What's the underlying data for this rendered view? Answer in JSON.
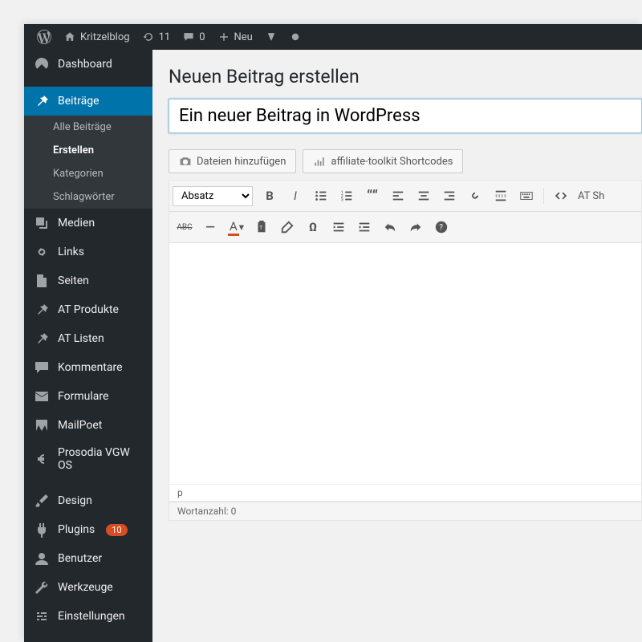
{
  "adminbar": {
    "site_name": "Kritzelblog",
    "updates_count": "11",
    "comments_count": "0",
    "new_label": "Neu"
  },
  "sidebar": {
    "dashboard": "Dashboard",
    "posts": "Beiträge",
    "posts_sub": {
      "all": "Alle Beiträge",
      "create": "Erstellen",
      "categories": "Kategorien",
      "tags": "Schlagwörter"
    },
    "media": "Medien",
    "links": "Links",
    "pages": "Seiten",
    "at_products": "AT Produkte",
    "at_lists": "AT Listen",
    "comments": "Kommentare",
    "forms": "Formulare",
    "mailpoet": "MailPoet",
    "prosodia": "Prosodia VGW OS",
    "design": "Design",
    "plugins": "Plugins",
    "plugins_badge": "10",
    "users": "Benutzer",
    "tools": "Werkzeuge",
    "settings": "Einstellungen"
  },
  "content": {
    "page_title": "Neuen Beitrag erstellen",
    "title_value": "Ein neuer Beitrag in WordPress",
    "add_media": "Dateien hinzufügen",
    "affiliate_shortcodes": "affiliate-toolkit Shortcodes",
    "format_select": "Absatz",
    "at_shortcodes_label": "AT Sh",
    "path": "p",
    "word_count": "Wortanzahl: 0"
  }
}
